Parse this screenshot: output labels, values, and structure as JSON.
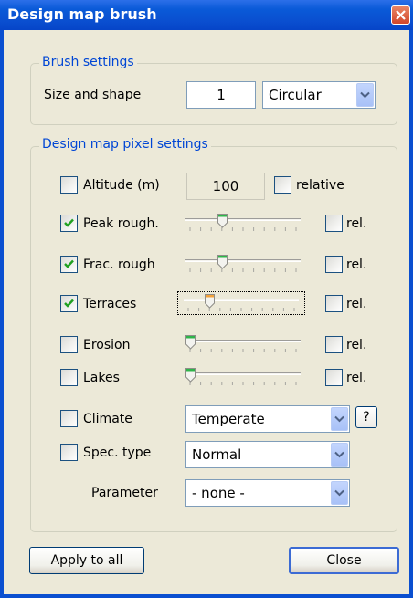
{
  "window": {
    "title": "Design map brush"
  },
  "brush": {
    "group_title": "Brush settings",
    "size_label": "Size and shape",
    "size_value": "1",
    "shape_value": "Circular"
  },
  "pixel": {
    "group_title": "Design map pixel settings",
    "altitude": {
      "label": "Altitude (m)",
      "checked": false,
      "value": "100",
      "relative_label": "relative",
      "relative_checked": false
    },
    "peak": {
      "label": "Peak rough.",
      "checked": true,
      "slider": 0.3,
      "rel_label": "rel."
    },
    "frac": {
      "label": "Frac. rough",
      "checked": true,
      "slider": 0.3,
      "rel_label": "rel."
    },
    "terraces": {
      "label": "Terraces",
      "checked": true,
      "slider": 0.2,
      "rel_label": "rel."
    },
    "erosion": {
      "label": "Erosion",
      "checked": false,
      "slider": 0.0,
      "rel_label": "rel."
    },
    "lakes": {
      "label": "Lakes",
      "checked": false,
      "slider": 0.0,
      "rel_label": "rel."
    },
    "climate": {
      "label": "Climate",
      "checked": false,
      "value": "Temperate",
      "help": "?"
    },
    "spec_type": {
      "label": "Spec. type",
      "checked": false,
      "value": "Normal"
    },
    "parameter": {
      "label": "Parameter",
      "value": "- none -"
    }
  },
  "buttons": {
    "apply_all": "Apply to all",
    "close": "Close"
  }
}
